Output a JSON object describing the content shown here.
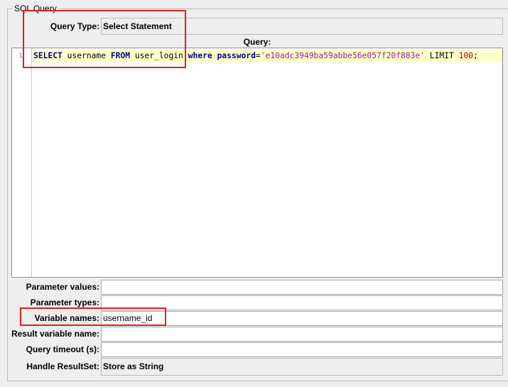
{
  "panel": {
    "title": "SQL Query"
  },
  "query_type": {
    "label": "Query Type:",
    "value": "Select Statement"
  },
  "query": {
    "header": "Query:",
    "line_number": "1",
    "tokens": [
      {
        "text": "SELECT",
        "kind": "kw"
      },
      {
        "text": " username ",
        "kind": "plain"
      },
      {
        "text": "FROM",
        "kind": "kw"
      },
      {
        "text": " user_login ",
        "kind": "plain"
      },
      {
        "text": "where",
        "kind": "kw"
      },
      {
        "text": " ",
        "kind": "plain"
      },
      {
        "text": "password",
        "kind": "kw"
      },
      {
        "text": "=",
        "kind": "plain"
      },
      {
        "text": "'e10adc3949ba59abbe56e057f20f883e'",
        "kind": "str"
      },
      {
        "text": " LIMIT ",
        "kind": "plain"
      },
      {
        "text": "100",
        "kind": "num"
      },
      {
        "text": ";",
        "kind": "plain"
      }
    ]
  },
  "parameter_values": {
    "label": "Parameter values:",
    "value": ""
  },
  "parameter_types": {
    "label": "Parameter types:",
    "value": ""
  },
  "variable_names": {
    "label": "Variable names:",
    "value": "username_id"
  },
  "result_variable_name": {
    "label": "Result variable name:",
    "value": ""
  },
  "query_timeout": {
    "label": "Query timeout (s):",
    "value": ""
  },
  "handle_resultset": {
    "label": "Handle ResultSet:",
    "value": "Store as String"
  },
  "colors": {
    "highlight_line": "#ffffcc",
    "annotation": "#dd1f1f",
    "keyword": "#00008b",
    "string": "#a0208f"
  }
}
